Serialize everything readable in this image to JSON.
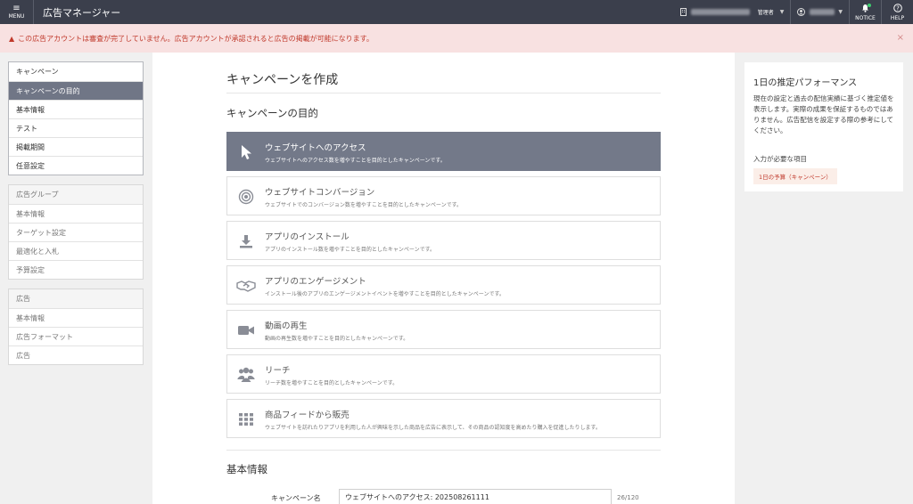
{
  "topbar": {
    "menu_icon": "≡",
    "menu_label": "MENU",
    "title": "広告マネージャー",
    "role": "管理者",
    "notice_label": "NOTICE",
    "help_label": "HELP"
  },
  "alert": {
    "text": "この広告アカウントは審査が完了していません。広告アカウントが承認されると広告の掲載が可能になります。",
    "close": "×"
  },
  "nav": {
    "campaign": [
      "キャンペーン",
      "キャンペーンの目的",
      "基本情報",
      "テスト",
      "掲載期間",
      "任意設定"
    ],
    "adgroup": [
      "広告グループ",
      "基本情報",
      "ターゲット設定",
      "最適化と入札",
      "予算設定"
    ],
    "ad": [
      "広告",
      "基本情報",
      "広告フォーマット",
      "広告"
    ]
  },
  "main": {
    "page_title": "キャンペーンを作成",
    "objective_title": "キャンペーンの目的",
    "objectives": [
      {
        "title": "ウェブサイトへのアクセス",
        "desc": "ウェブサイトへのアクセス数を増やすことを目的としたキャンペーンです。",
        "icon": "cursor-icon"
      },
      {
        "title": "ウェブサイトコンバージョン",
        "desc": "ウェブサイトでのコンバージョン数を増やすことを目的としたキャンペーンです。",
        "icon": "target-icon"
      },
      {
        "title": "アプリのインストール",
        "desc": "アプリのインストール数を増やすことを目的としたキャンペーンです。",
        "icon": "download-icon"
      },
      {
        "title": "アプリのエンゲージメント",
        "desc": "インストール後のアプリのエンゲージメントイベントを増やすことを目的としたキャンペーンです。",
        "icon": "handshake-icon"
      },
      {
        "title": "動画の再生",
        "desc": "動画の再生数を増やすことを目的としたキャンペーンです。",
        "icon": "video-icon"
      },
      {
        "title": "リーチ",
        "desc": "リーチ数を増やすことを目的としたキャンペーンです。",
        "icon": "users-icon"
      },
      {
        "title": "商品フィードから販売",
        "desc": "ウェブサイトを訪れたりアプリを利用した人が興味を示した商品を広告に表示して、その商品の認知度を高めたり購入を促進したりします。",
        "icon": "grid-icon"
      }
    ],
    "basic_title": "基本情報",
    "campaign_name_label": "キャンペーン名",
    "campaign_name_value": "ウェブサイトへのアクセス: 202508261111",
    "campaign_name_count": "26/120"
  },
  "right_panel": {
    "title": "1日の推定パフォーマンス",
    "desc": "現在の設定と過去の配信実績に基づく推定値を表示します。実際の成果を保証するものではありません。広告配信を設定する際の参考にしてください。",
    "required_label": "入力が必要な項目",
    "required_badge": "1日の予算（キャンペーン）"
  },
  "colors": {
    "topbar": "#3b3f4c",
    "active": "#707686",
    "alert_bg": "#f8e1e1",
    "alert_text": "#c0392b"
  }
}
